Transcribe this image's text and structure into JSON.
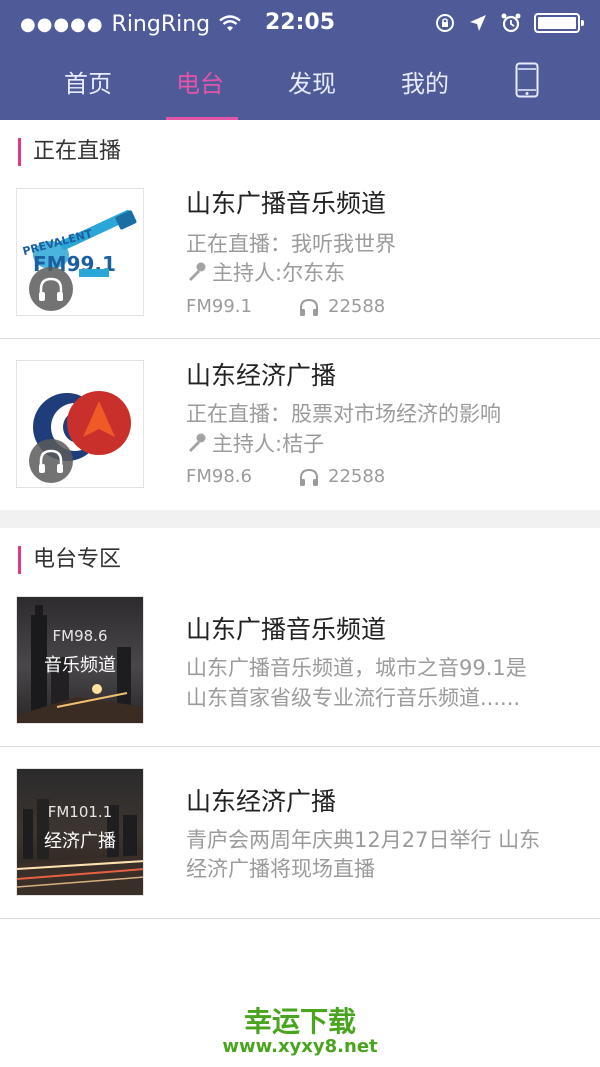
{
  "status_bar": {
    "signal_dots": "●●●●●",
    "carrier": "RingRing",
    "time": "22:05",
    "icons": [
      "wifi-icon",
      "rotation-lock-icon",
      "location-arrow-icon",
      "alarm-icon",
      "battery-icon"
    ]
  },
  "nav": {
    "tabs": [
      {
        "label": "首页",
        "active": false
      },
      {
        "label": "电台",
        "active": true
      },
      {
        "label": "发现",
        "active": false
      },
      {
        "label": "我的",
        "active": false
      }
    ],
    "device_icon": "phone-icon"
  },
  "live_section": {
    "title": "正在直播",
    "items": [
      {
        "name": "山东广播音乐频道",
        "now_playing": "正在直播：我听我世界",
        "host": "主持人:尔东东",
        "frequency": "FM99.1",
        "listeners": "22588",
        "logo_text": "FM99.1"
      },
      {
        "name": "山东经济广播",
        "now_playing": "正在直播：股票对市场经济的影响",
        "host": "主持人:桔子",
        "frequency": "FM98.6",
        "listeners": "22588"
      }
    ]
  },
  "zone_section": {
    "title": "电台专区",
    "items": [
      {
        "name": "山东广播音乐频道",
        "desc_line1": "山东广播音乐频道，城市之音99.1是",
        "desc_line2": "山东首家省级专业流行音乐频道......",
        "thumb_freq": "FM98.6",
        "thumb_name": "音乐频道"
      },
      {
        "name": "山东经济广播",
        "desc_line1": "青庐会两周年庆典12月27日举行 山东",
        "desc_line2": "经济广播将现场直播",
        "thumb_freq": "FM101.1",
        "thumb_name": "经济广播"
      }
    ]
  },
  "footer": {
    "brand": "幸运下载",
    "url": "www.xyxy8.net"
  },
  "colors": {
    "header_bg": "#4e5b98",
    "accent": "#e255a8",
    "footer_green": "#4aa51e"
  }
}
